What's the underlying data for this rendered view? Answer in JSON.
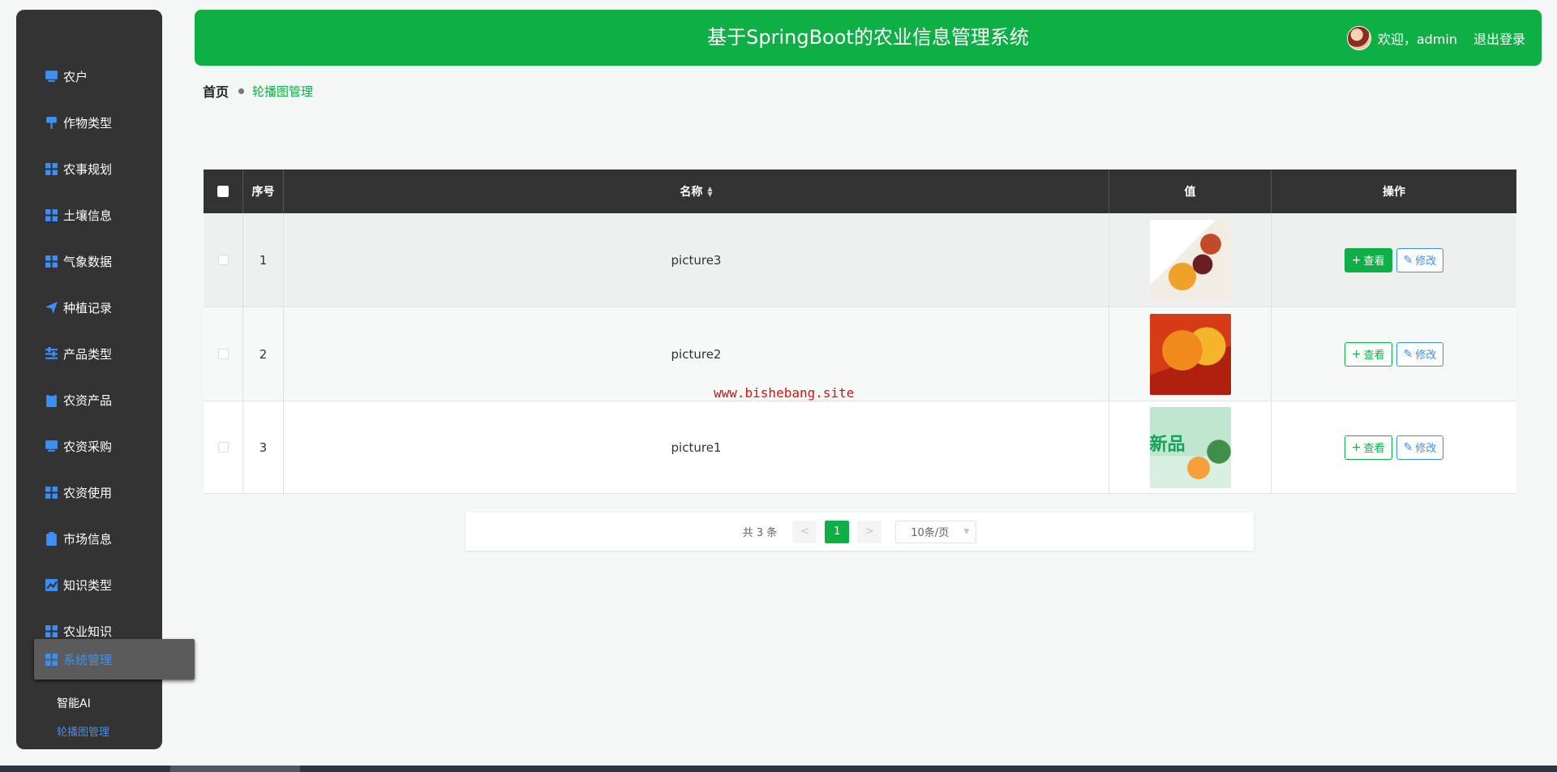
{
  "app": {
    "title": "基于SpringBoot的农业信息管理系统"
  },
  "user": {
    "welcome": "欢迎，admin",
    "logout": "退出登录"
  },
  "sidebar": {
    "items": [
      {
        "label": "农户",
        "icon": "monitor-icon"
      },
      {
        "label": "作物类型",
        "icon": "pin-icon"
      },
      {
        "label": "农事规划",
        "icon": "grid-icon"
      },
      {
        "label": "土壤信息",
        "icon": "grid-icon"
      },
      {
        "label": "气象数据",
        "icon": "grid-icon"
      },
      {
        "label": "种植记录",
        "icon": "send-icon"
      },
      {
        "label": "产品类型",
        "icon": "sliders-icon"
      },
      {
        "label": "农资产品",
        "icon": "clipboard-x-icon"
      },
      {
        "label": "农资采购",
        "icon": "monitor-icon"
      },
      {
        "label": "农资使用",
        "icon": "grid-icon"
      },
      {
        "label": "市场信息",
        "icon": "clipboard-check-icon"
      },
      {
        "label": "知识类型",
        "icon": "chart-icon"
      },
      {
        "label": "农业知识",
        "icon": "grid-icon"
      },
      {
        "label": "系统管理",
        "icon": "grid-icon"
      }
    ],
    "submenu": [
      {
        "label": "智能AI"
      },
      {
        "label": "轮播图管理"
      }
    ]
  },
  "breadcrumb": {
    "home": "首页",
    "current": "轮播图管理"
  },
  "table": {
    "headers": {
      "index": "序号",
      "name": "名称",
      "value": "值",
      "ops": "操作"
    },
    "rows": [
      {
        "index": "1",
        "name": "picture3",
        "thumb": "p3"
      },
      {
        "index": "2",
        "name": "picture2",
        "thumb": "p2"
      },
      {
        "index": "3",
        "name": "picture1",
        "thumb": "p1",
        "thumb_text": "新品"
      }
    ],
    "view_label": "查看",
    "edit_label": "修改"
  },
  "watermark": "www.bishebang.site",
  "pagination": {
    "total": "共 3 条",
    "prev": "<",
    "page": "1",
    "next": ">",
    "size": "10条/页"
  },
  "colors": {
    "primary": "#0eb046",
    "sidebar": "#333333",
    "accent": "#3d8ff5"
  }
}
